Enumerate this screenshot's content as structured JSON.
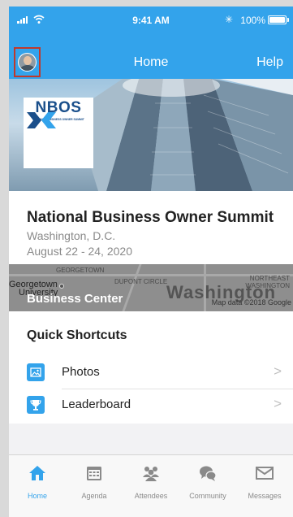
{
  "status_bar": {
    "time": "9:41 AM",
    "battery": "100%",
    "bluetooth_icon": "bluetooth-icon",
    "signal_icon": "signal-icon",
    "wifi_icon": "wifi-icon"
  },
  "nav": {
    "title": "Home",
    "help_label": "Help"
  },
  "logo": {
    "name": "NBOS",
    "tagline": "NATIONAL BUSINESS OWNER SUMMIT"
  },
  "event": {
    "title": "National Business Owner Summit",
    "location": "Washington, D.C.",
    "dates": "August 22 - 24, 2020"
  },
  "map": {
    "label": "Business Center",
    "city": "Washington",
    "neighborhoods": [
      "GEORGETOWN",
      "DUPONT CIRCLE",
      "NORTHEAST",
      "WASHINGTON"
    ],
    "georgetown": "Georgetown",
    "university": "University",
    "attribution": "Map data ©2018 Google"
  },
  "shortcuts": {
    "title": "Quick Shortcuts",
    "items": [
      {
        "label": "Photos",
        "icon": "photo-icon"
      },
      {
        "label": "Leaderboard",
        "icon": "trophy-icon"
      }
    ]
  },
  "tabbar": {
    "tabs": [
      {
        "label": "Home",
        "icon": "home-icon",
        "active": true
      },
      {
        "label": "Agenda",
        "icon": "agenda-icon"
      },
      {
        "label": "Attendees",
        "icon": "attendees-icon"
      },
      {
        "label": "Community",
        "icon": "community-icon"
      },
      {
        "label": "Messages",
        "icon": "messages-icon"
      }
    ]
  },
  "colors": {
    "primary": "#33a3eb",
    "highlight_border": "#c0392b",
    "logo_blue": "#1a4f8b"
  }
}
